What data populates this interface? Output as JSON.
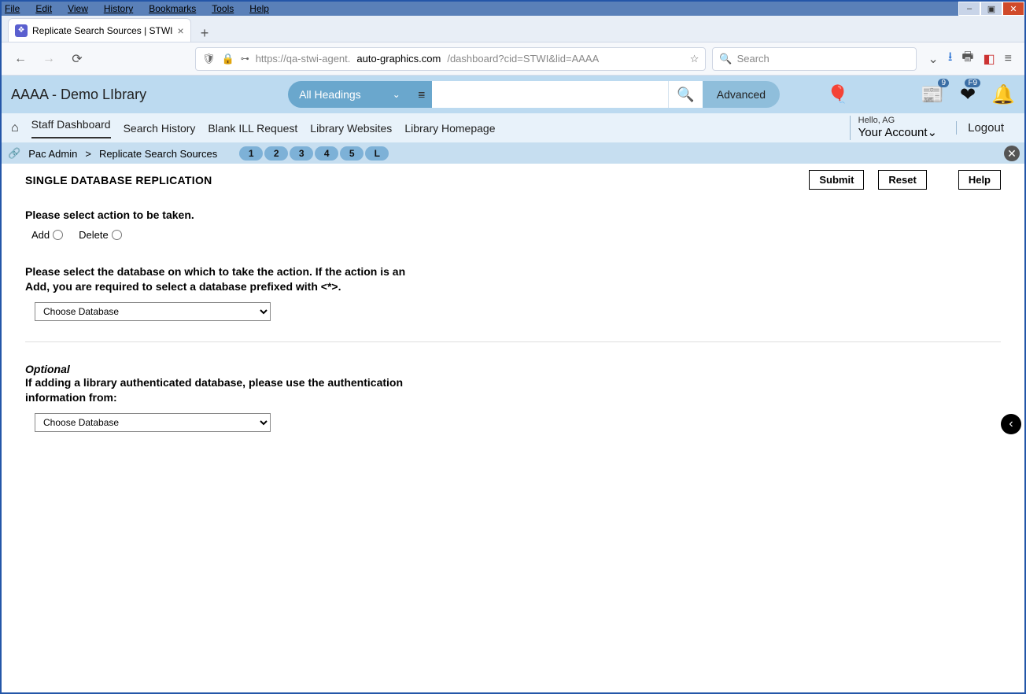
{
  "os_menu": [
    "File",
    "Edit",
    "View",
    "History",
    "Bookmarks",
    "Tools",
    "Help"
  ],
  "win_controls": {
    "min": "–",
    "max": "▣",
    "close": "✕"
  },
  "tab": {
    "title": "Replicate Search Sources | STWI",
    "close": "×",
    "new": "+"
  },
  "url": {
    "prefix": "https://qa-stwi-agent.",
    "domain": "auto-graphics.com",
    "path": "/dashboard?cid=STWI&lid=AAAA",
    "search_placeholder": "Search"
  },
  "app": {
    "library_name": "AAAA - Demo LIbrary",
    "dropdown_label": "All Headings",
    "advanced": "Advanced",
    "badges": {
      "list": "9",
      "heart": "F9"
    }
  },
  "nav": {
    "items": [
      "Staff Dashboard",
      "Search History",
      "Blank ILL Request",
      "Library Websites",
      "Library Homepage"
    ],
    "hello": "Hello, AG",
    "account": "Your Account",
    "logout": "Logout"
  },
  "breadcrumb": {
    "root": "Pac Admin",
    "sep": ">",
    "current": "Replicate Search Sources",
    "pages": [
      "1",
      "2",
      "3",
      "4",
      "5",
      "L"
    ]
  },
  "content": {
    "title": "SINGLE DATABASE REPLICATION",
    "submit": "Submit",
    "reset": "Reset",
    "help": "Help",
    "action_label": "Please select action to be taken.",
    "radio_add": "Add",
    "radio_delete": "Delete",
    "db_instr": "Please select the database on which to take the action. If the action is an Add, you are required to select a database prefixed with <*>.",
    "select_placeholder": "Choose Database",
    "optional": "Optional",
    "auth_instr": "If adding a library authenticated database, please use the authentication information from:"
  }
}
